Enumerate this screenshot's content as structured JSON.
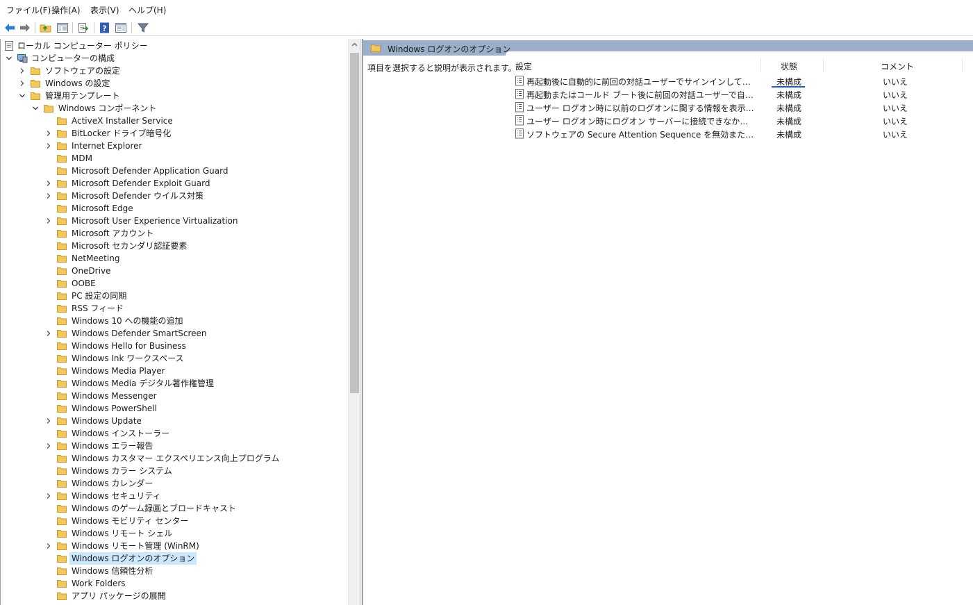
{
  "menu": [
    "ファイル(F)",
    "操作(A)",
    "表示(V)",
    "ヘルプ(H)"
  ],
  "toolbar_icons": [
    "back-arrow-icon",
    "forward-arrow-icon",
    "up-folder-icon",
    "show-hide-tree-icon",
    "export-list-icon",
    "help-icon",
    "properties-pane-icon",
    "filter-icon"
  ],
  "tree": {
    "root": "ローカル コンピューター ポリシー",
    "computer_config": "コンピューターの構成",
    "software_settings": "ソフトウェアの設定",
    "windows_settings": "Windows の設定",
    "admin_templates": "管理用テンプレート",
    "windows_components": "Windows コンポーネント",
    "items": [
      {
        "label": "ActiveX Installer Service",
        "expandable": false
      },
      {
        "label": "BitLocker ドライブ暗号化",
        "expandable": true
      },
      {
        "label": "Internet Explorer",
        "expandable": true
      },
      {
        "label": "MDM",
        "expandable": false
      },
      {
        "label": "Microsoft Defender Application Guard",
        "expandable": false
      },
      {
        "label": "Microsoft Defender Exploit Guard",
        "expandable": true
      },
      {
        "label": "Microsoft Defender ウイルス対策",
        "expandable": true
      },
      {
        "label": "Microsoft Edge",
        "expandable": false
      },
      {
        "label": "Microsoft User Experience Virtualization",
        "expandable": true
      },
      {
        "label": "Microsoft アカウント",
        "expandable": false
      },
      {
        "label": "Microsoft セカンダリ認証要素",
        "expandable": false
      },
      {
        "label": "NetMeeting",
        "expandable": false
      },
      {
        "label": "OneDrive",
        "expandable": false
      },
      {
        "label": "OOBE",
        "expandable": false
      },
      {
        "label": "PC 設定の同期",
        "expandable": false
      },
      {
        "label": "RSS フィード",
        "expandable": false
      },
      {
        "label": "Windows 10 への機能の追加",
        "expandable": false
      },
      {
        "label": "Windows Defender SmartScreen",
        "expandable": true
      },
      {
        "label": "Windows Hello for Business",
        "expandable": false
      },
      {
        "label": "Windows Ink ワークスペース",
        "expandable": false
      },
      {
        "label": "Windows Media Player",
        "expandable": false
      },
      {
        "label": "Windows Media デジタル著作権管理",
        "expandable": false
      },
      {
        "label": "Windows Messenger",
        "expandable": false
      },
      {
        "label": "Windows PowerShell",
        "expandable": false
      },
      {
        "label": "Windows Update",
        "expandable": true
      },
      {
        "label": "Windows インストーラー",
        "expandable": false
      },
      {
        "label": "Windows エラー報告",
        "expandable": true
      },
      {
        "label": "Windows カスタマー エクスペリエンス向上プログラム",
        "expandable": false
      },
      {
        "label": "Windows カラー システム",
        "expandable": false
      },
      {
        "label": "Windows カレンダー",
        "expandable": false
      },
      {
        "label": "Windows セキュリティ",
        "expandable": true
      },
      {
        "label": "Windows のゲーム録画とブロードキャスト",
        "expandable": false
      },
      {
        "label": "Windows モビリティ センター",
        "expandable": false
      },
      {
        "label": "Windows リモート シェル",
        "expandable": false
      },
      {
        "label": "Windows リモート管理 (WinRM)",
        "expandable": true
      },
      {
        "label": "Windows ログオンのオプション",
        "expandable": false,
        "selected": true
      },
      {
        "label": "Windows 信頼性分析",
        "expandable": false
      },
      {
        "label": "Work Folders",
        "expandable": false
      },
      {
        "label": "アプリ パッケージの展開",
        "expandable": false
      }
    ]
  },
  "right": {
    "header_title": "Windows ログオンのオプション",
    "description": "項目を選択すると説明が表示されます。",
    "columns": {
      "setting": "設定",
      "state": "状態",
      "comment": "コメント"
    },
    "policies": [
      {
        "name": "再起動後に自動的に前回の対話ユーザーでサインインしてロックする",
        "state": "未構成",
        "comment": "いいえ"
      },
      {
        "name": "再起動またはコールド ブート後に前回の対話ユーザーで自動的にサインインしてロックする",
        "state": "未構成",
        "comment": "いいえ"
      },
      {
        "name": "ユーザー ログオン時に以前のログオンに関する情報を表示する",
        "state": "未構成",
        "comment": "いいえ"
      },
      {
        "name": "ユーザー ログオン時にログオン サーバーに接続できなかった場合に報告する",
        "state": "未構成",
        "comment": "いいえ"
      },
      {
        "name": "ソフトウェアの Secure Attention Sequence を無効または有効にする",
        "state": "未構成",
        "comment": "いいえ"
      }
    ]
  },
  "colors": {
    "header_bar": "#9bb0c8",
    "selection": "#cce8ff",
    "folder": "#f2c75c",
    "sort_indicator": "#1f5fcc"
  }
}
